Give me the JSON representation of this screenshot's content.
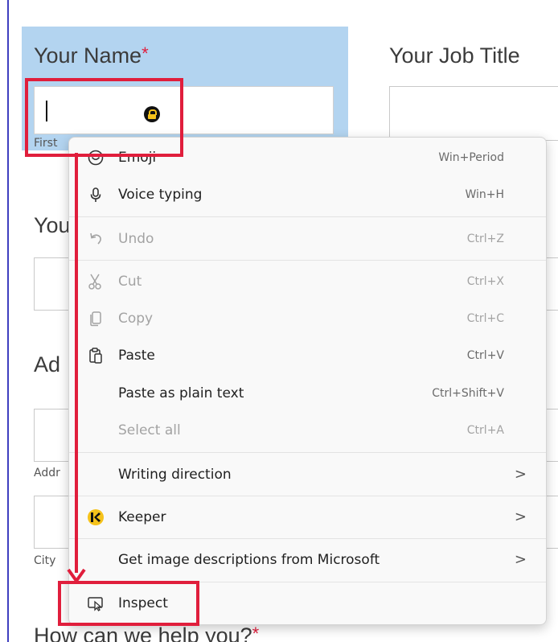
{
  "form": {
    "name_label": "Your Name",
    "required_mark": "*",
    "job_title_label": "Your Job Title",
    "first_sublabel": "First",
    "heading_your_partial": "You",
    "heading_address_partial": "Ad",
    "address_sublabel_partial": "Addr",
    "city_sublabel": "City",
    "help_label": "How can we help you?"
  },
  "context_menu": {
    "items": [
      {
        "label": "Emoji",
        "shortcut": "Win+Period",
        "icon": "emoji-icon",
        "disabled": false
      },
      {
        "label": "Voice typing",
        "shortcut": "Win+H",
        "icon": "microphone-icon",
        "disabled": false
      },
      {
        "label": "Undo",
        "shortcut": "Ctrl+Z",
        "icon": "undo-icon",
        "disabled": true
      },
      {
        "label": "Cut",
        "shortcut": "Ctrl+X",
        "icon": "scissors-icon",
        "disabled": true
      },
      {
        "label": "Copy",
        "shortcut": "Ctrl+C",
        "icon": "copy-icon",
        "disabled": true
      },
      {
        "label": "Paste",
        "shortcut": "Ctrl+V",
        "icon": "clipboard-icon",
        "disabled": false
      },
      {
        "label": "Paste as plain text",
        "shortcut": "Ctrl+Shift+V",
        "icon": "",
        "disabled": false
      },
      {
        "label": "Select all",
        "shortcut": "Ctrl+A",
        "icon": "",
        "disabled": true
      },
      {
        "label": "Writing direction",
        "shortcut": "",
        "icon": "",
        "disabled": false,
        "submenu": true
      },
      {
        "label": "Keeper",
        "shortcut": "",
        "icon": "keeper-logo-icon",
        "disabled": false,
        "submenu": true
      },
      {
        "label": "Get image descriptions from Microsoft",
        "shortcut": "",
        "icon": "",
        "disabled": false,
        "submenu": true
      },
      {
        "label": "Inspect",
        "shortcut": "",
        "icon": "inspect-icon",
        "disabled": false
      }
    ],
    "chevron": ">"
  },
  "colors": {
    "highlight_red": "#e01e3c",
    "name_section_bg": "#b3d4f0",
    "keeper_yellow": "#f5c21b"
  }
}
